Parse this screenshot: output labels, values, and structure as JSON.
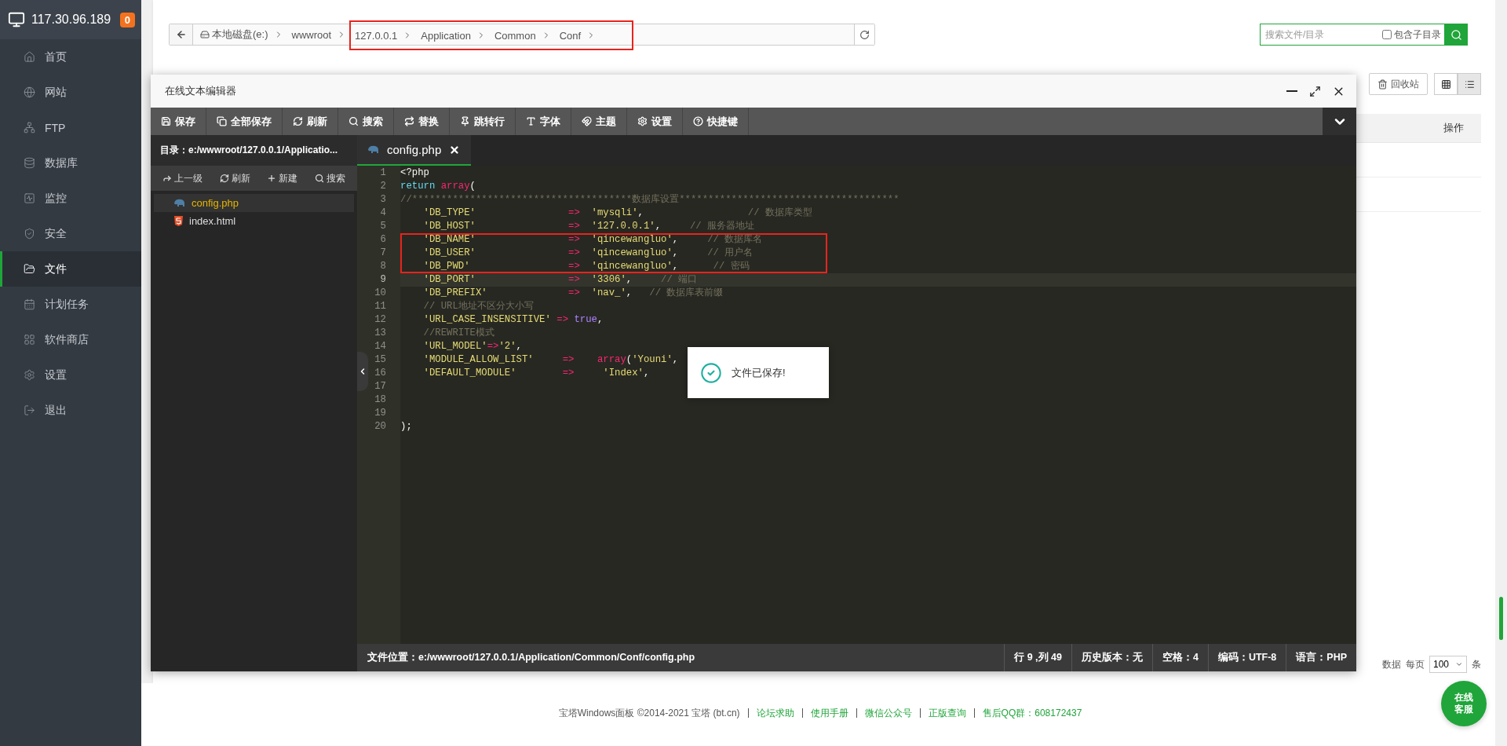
{
  "sidebar": {
    "host": "117.30.96.189",
    "badge": "0",
    "items": [
      {
        "label": "首页",
        "selected": false
      },
      {
        "label": "网站",
        "selected": false
      },
      {
        "label": "FTP",
        "selected": false
      },
      {
        "label": "数据库",
        "selected": false
      },
      {
        "label": "监控",
        "selected": false
      },
      {
        "label": "安全",
        "selected": false
      },
      {
        "label": "文件",
        "selected": true
      },
      {
        "label": "计划任务",
        "selected": false
      },
      {
        "label": "软件商店",
        "selected": false
      },
      {
        "label": "设置",
        "selected": false
      },
      {
        "label": "退出",
        "selected": false
      }
    ]
  },
  "breadcrumb": [
    {
      "label": "本地磁盘(e:)",
      "highlighted": false
    },
    {
      "label": "wwwroot",
      "highlighted": false
    },
    {
      "label": "127.0.0.1",
      "highlighted": true
    },
    {
      "label": "Application",
      "highlighted": true
    },
    {
      "label": "Common",
      "highlighted": true
    },
    {
      "label": "Conf",
      "highlighted": true
    }
  ],
  "search": {
    "placeholder": "搜索文件/目录",
    "subdir_label": "包含子目录",
    "subdir_checked": false
  },
  "toolbar": {
    "recycle_label": "回收站",
    "views": [
      {
        "selected": false
      },
      {
        "selected": true
      }
    ]
  },
  "table": {
    "action_column": "操作"
  },
  "pager": {
    "count_tail": "数据",
    "per_page_label": "每页",
    "per_page": "100",
    "unit": "条"
  },
  "footer": {
    "copyright": "宝塔Windows面板 ©2014-2021 宝塔 (bt.cn)",
    "links": [
      "论坛求助",
      "使用手册",
      "微信公众号",
      "正版查询",
      "售后QQ群：608172437"
    ]
  },
  "chat_button": "在线客服",
  "editor": {
    "title": "在线文本编辑器",
    "toolbar": [
      "保存",
      "全部保存",
      "刷新",
      "搜索",
      "替换",
      "跳转行",
      "字体",
      "主题",
      "设置",
      "快捷键"
    ],
    "directory": "目录：e:/wwwroot/127.0.0.1/Applicatio...",
    "dir_actions": [
      "上一级",
      "刷新",
      "新建",
      "搜索"
    ],
    "files": [
      {
        "name": "config.php",
        "kind": "php",
        "selected": true
      },
      {
        "name": "index.html",
        "kind": "html",
        "selected": false
      }
    ],
    "tabs": [
      {
        "label": "config.php",
        "selected": true
      }
    ],
    "lines": [
      {
        "number": "1",
        "active": false,
        "highlighted": false,
        "tokens": [
          {
            "kind": "plain",
            "text": "<?php"
          }
        ]
      },
      {
        "number": "2",
        "active": false,
        "highlighted": false,
        "tokens": [
          {
            "kind": "keyword",
            "text": "return"
          },
          {
            "kind": "fn",
            "text": " array"
          },
          {
            "kind": "plain",
            "text": "("
          }
        ]
      },
      {
        "number": "3",
        "active": false,
        "highlighted": false,
        "tokens": [
          {
            "kind": "comment",
            "text": "//**************************************数据库设置**************************************"
          }
        ]
      },
      {
        "number": "4",
        "active": false,
        "highlighted": false,
        "tokens": [
          {
            "kind": "string",
            "text": "    'DB_TYPE'"
          },
          {
            "kind": "op",
            "text": "                =>"
          },
          {
            "kind": "string",
            "text": "  'mysqli'"
          },
          {
            "kind": "plain",
            "text": ","
          },
          {
            "kind": "comment",
            "text": "                  // 数据库类型"
          }
        ]
      },
      {
        "number": "5",
        "active": false,
        "highlighted": false,
        "tokens": [
          {
            "kind": "string",
            "text": "    'DB_HOST'"
          },
          {
            "kind": "op",
            "text": "                =>"
          },
          {
            "kind": "string",
            "text": "  '127.0.0.1'"
          },
          {
            "kind": "plain",
            "text": ","
          },
          {
            "kind": "comment",
            "text": "     // 服务器地址"
          }
        ]
      },
      {
        "number": "6",
        "active": false,
        "highlighted": true,
        "tokens": [
          {
            "kind": "string",
            "text": "    'DB_NAME'"
          },
          {
            "kind": "op",
            "text": "                =>"
          },
          {
            "kind": "string",
            "text": "  'qincewangluo'"
          },
          {
            "kind": "plain",
            "text": ","
          },
          {
            "kind": "comment",
            "text": "     // 数据库名"
          }
        ]
      },
      {
        "number": "7",
        "active": false,
        "highlighted": true,
        "tokens": [
          {
            "kind": "string",
            "text": "    'DB_USER'"
          },
          {
            "kind": "op",
            "text": "                =>"
          },
          {
            "kind": "string",
            "text": "  'qincewangluo'"
          },
          {
            "kind": "plain",
            "text": ","
          },
          {
            "kind": "comment",
            "text": "     // 用户名"
          }
        ]
      },
      {
        "number": "8",
        "active": false,
        "highlighted": true,
        "tokens": [
          {
            "kind": "string",
            "text": "    'DB_PWD'"
          },
          {
            "kind": "op",
            "text": "                 =>"
          },
          {
            "kind": "string",
            "text": "  'qincewangluo'"
          },
          {
            "kind": "plain",
            "text": ","
          },
          {
            "kind": "comment",
            "text": "      // 密码"
          }
        ]
      },
      {
        "number": "9",
        "active": true,
        "highlighted": false,
        "tokens": [
          {
            "kind": "string",
            "text": "    'DB_PORT'"
          },
          {
            "kind": "op",
            "text": "                =>"
          },
          {
            "kind": "string",
            "text": "  '3306'"
          },
          {
            "kind": "plain",
            "text": ","
          },
          {
            "kind": "comment",
            "text": "     // 端口"
          }
        ]
      },
      {
        "number": "10",
        "active": false,
        "highlighted": false,
        "tokens": [
          {
            "kind": "string",
            "text": "    'DB_PREFIX'"
          },
          {
            "kind": "op",
            "text": "              =>"
          },
          {
            "kind": "string",
            "text": "  'nav_'"
          },
          {
            "kind": "plain",
            "text": ","
          },
          {
            "kind": "comment",
            "text": "   // 数据库表前缀"
          }
        ]
      },
      {
        "number": "11",
        "active": false,
        "highlighted": false,
        "tokens": [
          {
            "kind": "comment",
            "text": "    // URL地址不区分大小写"
          }
        ]
      },
      {
        "number": "12",
        "active": false,
        "highlighted": false,
        "tokens": [
          {
            "kind": "string",
            "text": "    'URL_CASE_INSENSITIVE'"
          },
          {
            "kind": "op",
            "text": " =>"
          },
          {
            "kind": "bool",
            "text": " true"
          },
          {
            "kind": "plain",
            "text": ","
          }
        ]
      },
      {
        "number": "13",
        "active": false,
        "highlighted": false,
        "tokens": [
          {
            "kind": "comment",
            "text": "    //REWRITE模式"
          }
        ]
      },
      {
        "number": "14",
        "active": false,
        "highlighted": false,
        "tokens": [
          {
            "kind": "string",
            "text": "    'URL_MODEL'"
          },
          {
            "kind": "op",
            "text": "=>"
          },
          {
            "kind": "string",
            "text": "'2'"
          },
          {
            "kind": "plain",
            "text": ","
          }
        ]
      },
      {
        "number": "15",
        "active": false,
        "highlighted": false,
        "tokens": [
          {
            "kind": "string",
            "text": "    'MODULE_ALLOW_LIST'"
          },
          {
            "kind": "op",
            "text": "     =>"
          },
          {
            "kind": "fn",
            "text": "    array"
          },
          {
            "kind": "plain",
            "text": "("
          },
          {
            "kind": "string",
            "text": "'Youni'"
          },
          {
            "kind": "plain",
            "text": ","
          }
        ]
      },
      {
        "number": "16",
        "active": false,
        "highlighted": false,
        "tokens": [
          {
            "kind": "string",
            "text": "    'DEFAULT_MODULE'"
          },
          {
            "kind": "op",
            "text": "        =>"
          },
          {
            "kind": "string",
            "text": "     'Index'"
          },
          {
            "kind": "plain",
            "text": ","
          }
        ]
      },
      {
        "number": "17",
        "active": false,
        "highlighted": false
      },
      {
        "number": "18",
        "active": false,
        "highlighted": false
      },
      {
        "number": "19",
        "active": false,
        "highlighted": false
      },
      {
        "number": "20",
        "active": false,
        "highlighted": false,
        "tokens": [
          {
            "kind": "plain",
            "text": ");"
          }
        ]
      }
    ],
    "status": {
      "path": "文件位置：e:/wwwroot/127.0.0.1/Application/Common/Conf/config.php",
      "cursor": "行 9 ,列 49",
      "history": "历史版本：无",
      "indent": "空格：4",
      "encoding": "编码：UTF-8",
      "language": "语言：PHP"
    }
  },
  "toast": {
    "message": "文件已保存!"
  }
}
